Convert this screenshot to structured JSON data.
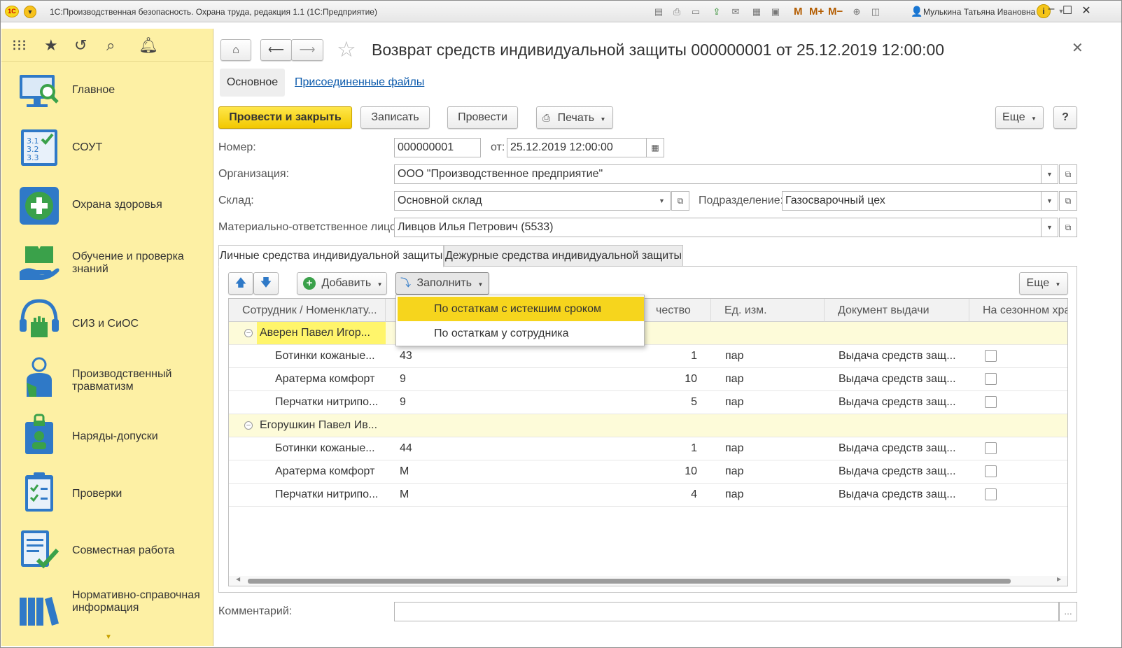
{
  "window": {
    "title": "1С:Производственная безопасность. Охрана труда, редакция 1.1  (1С:Предприятие)",
    "user": "Мулькина Татьяна Ивановна",
    "toolbar_marks": [
      "M",
      "M+",
      "M−"
    ]
  },
  "sidebar": {
    "sections": [
      {
        "label": "Главное",
        "icon": "monitor-search-icon"
      },
      {
        "label": "СОУТ",
        "icon": "checklist-icon"
      },
      {
        "label": "Охрана здоровья",
        "icon": "medical-cross-icon"
      },
      {
        "label": "Обучение и проверка знаний",
        "icon": "book-hand-icon"
      },
      {
        "label": "СИЗ и СиОС",
        "icon": "head-gloves-icon"
      },
      {
        "label": "Производственный травматизм",
        "icon": "injured-person-icon"
      },
      {
        "label": "Наряды-допуски",
        "icon": "badge-lock-icon"
      },
      {
        "label": "Проверки",
        "icon": "clipboard-check-icon"
      },
      {
        "label": "Совместная работа",
        "icon": "document-check-icon"
      },
      {
        "label": "Нормативно-справочная информация",
        "icon": "books-icon"
      }
    ]
  },
  "document": {
    "title": "Возврат средств индивидуальной защиты 000000001 от 25.12.2019 12:00:00",
    "tabs": {
      "main": "Основное",
      "files": "Присоединенные файлы"
    },
    "actions": {
      "post_close": "Провести и закрыть",
      "save": "Записать",
      "post": "Провести",
      "print": "Печать",
      "more": "Еще",
      "help": "?"
    },
    "fields": {
      "number_label": "Номер:",
      "number_value": "000000001",
      "date_label": "от:",
      "date_value": "25.12.2019 12:00:00",
      "org_label": "Организация:",
      "org_value": "ООО \"Производственное предприятие\"",
      "warehouse_label": "Склад:",
      "warehouse_value": "Основной склад",
      "division_label": "Подразделение:",
      "division_value": "Газосварочный цех",
      "mol_label": "Материально-ответственное лицо:",
      "mol_value": "Ливцов Илья Петрович (5533)",
      "comment_label": "Комментарий:",
      "comment_value": ""
    },
    "panel_tabs": [
      "Личные средства индивидуальной защиты",
      "Дежурные средства индивидуальной защиты"
    ],
    "table_toolbar": {
      "add": "Добавить",
      "fill": "Заполнить",
      "more": "Еще"
    },
    "fill_menu": [
      "По остаткам с истекшим сроком",
      "По остаткам у сотрудника"
    ],
    "columns": [
      "Сотрудник / Номенклату...",
      "",
      "чество",
      "Ед. изм.",
      "Документ выдачи",
      "На сезонном хра"
    ],
    "groups": [
      {
        "employee": "Аверен Павел Игор...",
        "rows": [
          {
            "item": "Ботинки кожаные...",
            "size": "43",
            "qty": "1",
            "unit": "пар",
            "doc": "Выдача средств защ...",
            "seasonal": false
          },
          {
            "item": "Аратерма комфорт",
            "size": "9",
            "qty": "10",
            "unit": "пар",
            "doc": "Выдача средств защ...",
            "seasonal": false
          },
          {
            "item": "Перчатки нитрипо...",
            "size": "9",
            "qty": "5",
            "unit": "пар",
            "doc": "Выдача средств защ...",
            "seasonal": false
          }
        ]
      },
      {
        "employee": "Егорушкин Павел Ив...",
        "rows": [
          {
            "item": "Ботинки кожаные...",
            "size": "44",
            "qty": "1",
            "unit": "пар",
            "doc": "Выдача средств защ...",
            "seasonal": false
          },
          {
            "item": "Аратерма комфорт",
            "size": "M",
            "qty": "10",
            "unit": "пар",
            "doc": "Выдача средств защ...",
            "seasonal": false
          },
          {
            "item": "Перчатки нитрипо...",
            "size": "M",
            "qty": "4",
            "unit": "пар",
            "doc": "Выдача средств защ...",
            "seasonal": false
          }
        ]
      }
    ]
  },
  "colors": {
    "accent": "#f2c800",
    "sidebar": "#fdf0a4",
    "link": "#0a59ab",
    "selected_group": "#fff56b"
  }
}
